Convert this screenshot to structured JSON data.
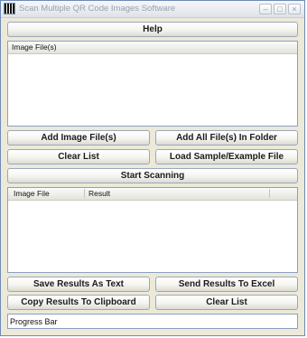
{
  "window": {
    "title": "Scan Multiple QR Code Images Software"
  },
  "controls": {
    "minimize": "–",
    "maximize": "□",
    "close": "×"
  },
  "buttons": {
    "help": "Help",
    "add_image_files": "Add Image File(s)",
    "add_all_files_folder": "Add All File(s) In Folder",
    "clear_list_top": "Clear List",
    "load_sample": "Load Sample/Example File",
    "start_scanning": "Start Scanning",
    "save_results_text": "Save Results As Text",
    "send_results_excel": "Send Results To Excel",
    "copy_results_clipboard": "Copy Results To Clipboard",
    "clear_list_bottom": "Clear List"
  },
  "image_files_list": {
    "header": "Image File(s)",
    "rows": []
  },
  "results_table": {
    "columns": [
      "Image File",
      "Result"
    ],
    "rows": []
  },
  "progress_bar": {
    "label": "Progress Bar"
  }
}
